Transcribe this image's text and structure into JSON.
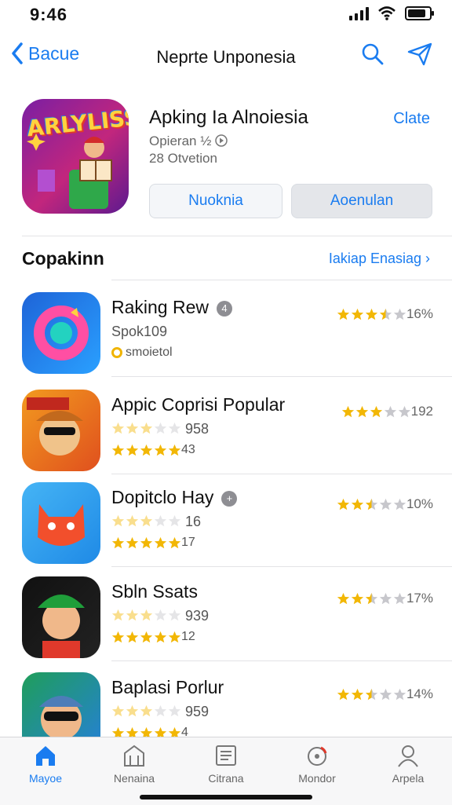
{
  "status": {
    "time": "9:46"
  },
  "nav": {
    "back_label": "Bacue",
    "title": "Neprte Unponesia"
  },
  "hero": {
    "icon_text": "ARLYLISS",
    "title": "Apking Ia Alnoiesia",
    "subtitle1": "Opieran ½",
    "subtitle2": "28 Otvetion",
    "link": "Clate",
    "button1": "Nuoknia",
    "button2": "Aoenulan"
  },
  "section": {
    "heading": "Copakinn",
    "see_all": "Iakiap Enasiag ›"
  },
  "apps": [
    {
      "name": "Raking Rew",
      "line2": "Spok109",
      "line3": "smoietol",
      "rating_value": "16%",
      "stars": 3.5,
      "colors": [
        "#1e64d8",
        "#2aa0ff"
      ]
    },
    {
      "name": "Appic Coprisi Popular",
      "line2": "958",
      "line3": "43",
      "rating_value": "192",
      "stars": 3,
      "colors": [
        "#f29a1f",
        "#e0501e"
      ]
    },
    {
      "name": "Dopitclo Hay",
      "line2": "16",
      "line3": "17",
      "rating_value": "10%",
      "stars": 2.5,
      "colors": [
        "#45b4f5",
        "#1f8ae6"
      ]
    },
    {
      "name": "Sbln Ssats",
      "line2": "939",
      "line3": "12",
      "rating_value": "17%",
      "stars": 2.5,
      "colors": [
        "#111111",
        "#222222"
      ]
    },
    {
      "name": "Baplasi Porlur",
      "line2": "959",
      "line3": "4",
      "rating_value": "14%",
      "stars": 2.5,
      "colors": [
        "#1f9e5a",
        "#2580d8"
      ]
    }
  ],
  "tabs": [
    {
      "label": "Mayoe",
      "icon": "home-icon"
    },
    {
      "label": "Nenaina",
      "icon": "building-icon"
    },
    {
      "label": "Citrana",
      "icon": "list-icon"
    },
    {
      "label": "Mondor",
      "icon": "monitor-icon"
    },
    {
      "label": "Arpela",
      "icon": "person-icon"
    }
  ],
  "colors": {
    "accent": "#1a7cf0",
    "star": "#f2b705",
    "star_empty": "#c7c7cc"
  }
}
